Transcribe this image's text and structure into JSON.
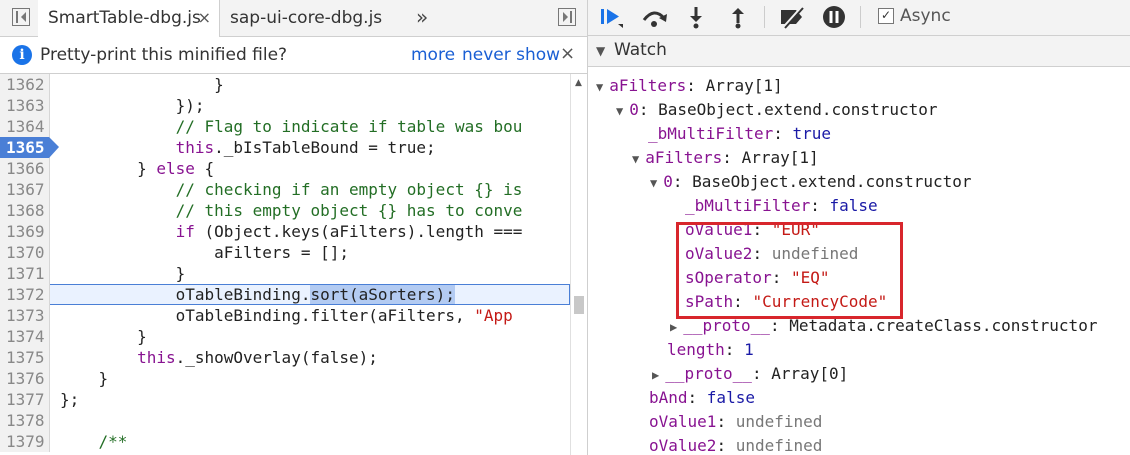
{
  "left": {
    "tabs": [
      {
        "label": "SmartTable-dbg.js",
        "close": "×"
      },
      {
        "label": "sap-ui-core-dbg.js"
      }
    ],
    "more_tabs": "»",
    "infobar": {
      "icon": "i",
      "text": "Pretty-print this minified file?",
      "more": "more",
      "never": "never show",
      "close": "×"
    },
    "lines": [
      {
        "n": "1362",
        "code": "                }"
      },
      {
        "n": "1363",
        "code": "            });"
      },
      {
        "n": "1364",
        "code": "            // Flag to indicate if table was bou"
      },
      {
        "n": "1365",
        "code": "            this._bIsTableBound = true;"
      },
      {
        "n": "1366",
        "code": "        } else {"
      },
      {
        "n": "1367",
        "code": "            // checking if an empty object {} is"
      },
      {
        "n": "1368",
        "code": "            // this empty object {} has to conve"
      },
      {
        "n": "1369",
        "code": "            if (Object.keys(aFilters).length ==="
      },
      {
        "n": "1370",
        "code": "                aFilters = [];"
      },
      {
        "n": "1371",
        "code": "            }"
      },
      {
        "n": "1372",
        "code": "            oTableBinding.sort(aSorters);"
      },
      {
        "n": "1373",
        "code": "            oTableBinding.filter(aFilters, \"App"
      },
      {
        "n": "1374",
        "code": "        }"
      },
      {
        "n": "1375",
        "code": "        this._showOverlay(false);"
      },
      {
        "n": "1376",
        "code": "    }"
      },
      {
        "n": "1377",
        "code": "};"
      },
      {
        "n": "1378",
        "code": ""
      },
      {
        "n": "1379",
        "code": "    /**"
      }
    ],
    "breakpoint_line": "1365",
    "current_line": "1372"
  },
  "right": {
    "toolbar": {
      "icons": [
        "resume-icon",
        "step-over-icon",
        "step-into-icon",
        "step-out-icon",
        "deactivate-breakpoints-icon",
        "pause-on-exceptions-icon"
      ],
      "async_label": "Async",
      "async_checked": "✓"
    },
    "watch": {
      "title": "Watch",
      "rows": [
        {
          "k": "aFilters",
          "v": "Array[1]"
        },
        {
          "k": "0",
          "v": "BaseObject.extend.constructor"
        },
        {
          "k": "_bMultiFilter",
          "v": "true"
        },
        {
          "k": "aFilters",
          "v": "Array[1]"
        },
        {
          "k": "0",
          "v": "BaseObject.extend.constructor"
        },
        {
          "k": "_bMultiFilter",
          "v": "false"
        },
        {
          "k": "oValue1",
          "v": "\"EUR\""
        },
        {
          "k": "oValue2",
          "v": "undefined"
        },
        {
          "k": "sOperator",
          "v": "\"EQ\""
        },
        {
          "k": "sPath",
          "v": "\"CurrencyCode\""
        },
        {
          "k": "__proto__",
          "v": "Metadata.createClass.constructor"
        },
        {
          "k": "length",
          "v": "1"
        },
        {
          "k": "__proto__",
          "v": "Array[0]"
        },
        {
          "k": "bAnd",
          "v": "false"
        },
        {
          "k": "oValue1",
          "v": "undefined"
        },
        {
          "k": "oValue2",
          "v": "undefined"
        }
      ]
    }
  }
}
